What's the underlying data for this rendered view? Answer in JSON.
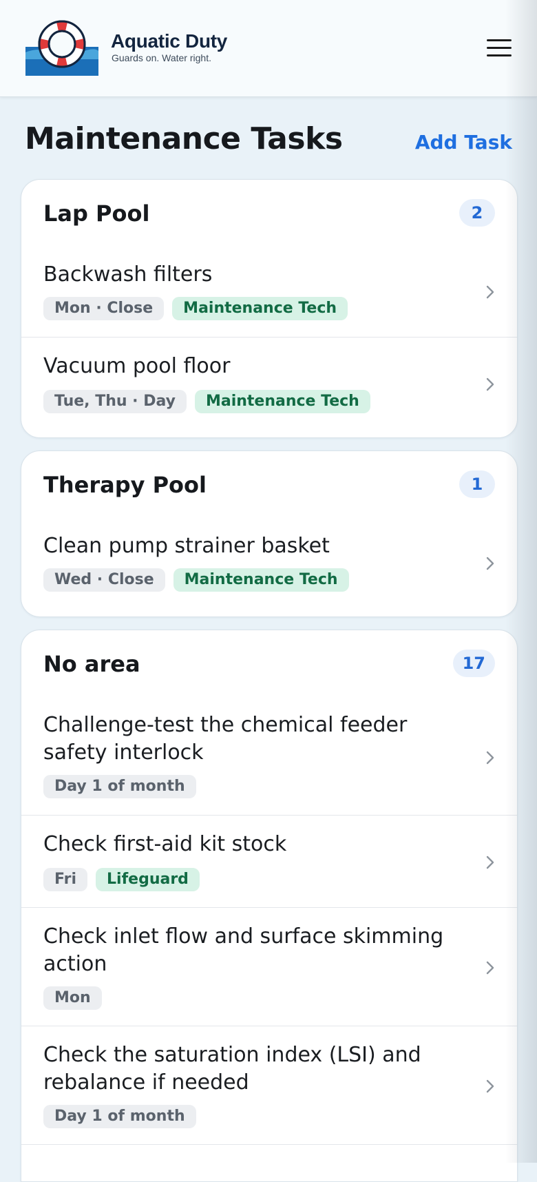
{
  "header": {
    "brand_name": "Aquatic Duty",
    "tagline": "Guards on. Water right.",
    "logo_icon": "lifebuoy-icon",
    "menu_icon": "hamburger-menu-icon"
  },
  "page": {
    "title": "Maintenance Tasks",
    "add_task_label": "Add Task"
  },
  "colors": {
    "accent": "#1f6fe0",
    "role_tag_text": "#126b44",
    "role_tag_bg": "#d7f2e6",
    "schedule_tag_bg": "#eceef1",
    "lifebuoy_red": "#e03a3a",
    "water_blue": "#1b6fb8"
  },
  "groups": [
    {
      "area": "Lap Pool",
      "count": "2",
      "tasks": [
        {
          "name": "Backwash filters",
          "schedule": "Mon · Close",
          "role": "Maintenance Tech"
        },
        {
          "name": "Vacuum pool floor",
          "schedule": "Tue, Thu · Day",
          "role": "Maintenance Tech"
        }
      ]
    },
    {
      "area": "Therapy Pool",
      "count": "1",
      "tasks": [
        {
          "name": "Clean pump strainer basket",
          "schedule": "Wed · Close",
          "role": "Maintenance Tech"
        }
      ]
    },
    {
      "area": "No area",
      "count": "17",
      "tasks": [
        {
          "name": "Challenge-test the chemical feeder safety interlock",
          "schedule": "Day 1 of month"
        },
        {
          "name": "Check first-aid kit stock",
          "schedule": "Fri",
          "role": "Lifeguard"
        },
        {
          "name": "Check inlet flow and surface skimming action",
          "schedule": "Mon"
        },
        {
          "name": "Check the saturation index (LSI) and rebalance if needed",
          "schedule": "Day 1 of month"
        }
      ]
    }
  ]
}
